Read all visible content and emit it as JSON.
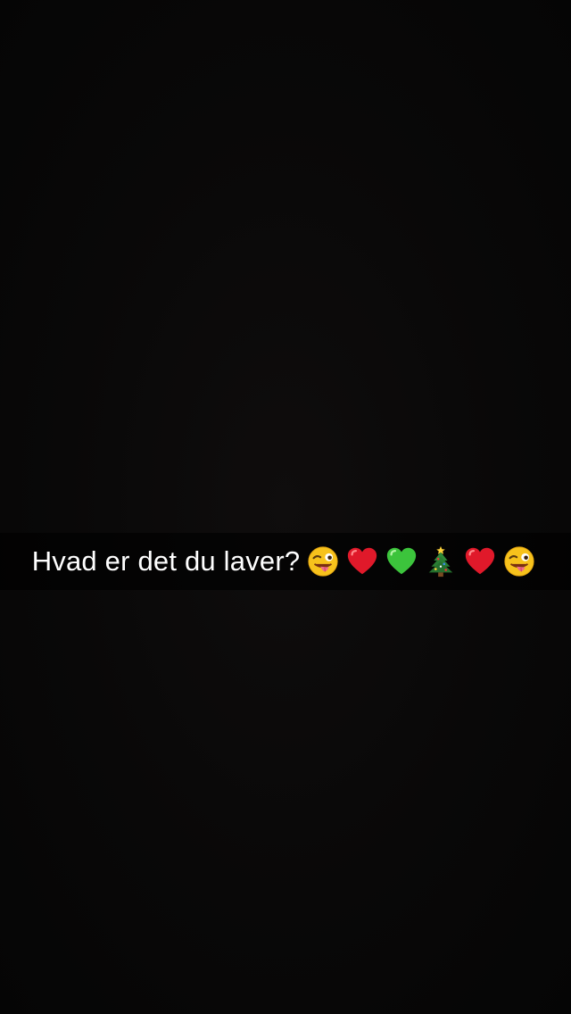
{
  "caption": {
    "text": "Hvad er det du laver?",
    "emojis": [
      {
        "icon": "winking-face-with-tongue-icon",
        "char": "😜"
      },
      {
        "icon": "red-heart-icon",
        "char": "❤️"
      },
      {
        "icon": "green-heart-icon",
        "char": "💚"
      },
      {
        "icon": "christmas-tree-icon",
        "char": "🎄"
      },
      {
        "icon": "red-heart-icon",
        "char": "❤️"
      },
      {
        "icon": "winking-face-with-tongue-icon",
        "char": "😜"
      }
    ]
  },
  "colors": {
    "background": "#070707",
    "caption_bar": "rgba(0,0,0,0.62)",
    "text": "#ffffff",
    "red_heart": "#e0192a",
    "green_heart": "#3cc43c",
    "tree": "#2e7d32",
    "face": "#f5c21b"
  }
}
